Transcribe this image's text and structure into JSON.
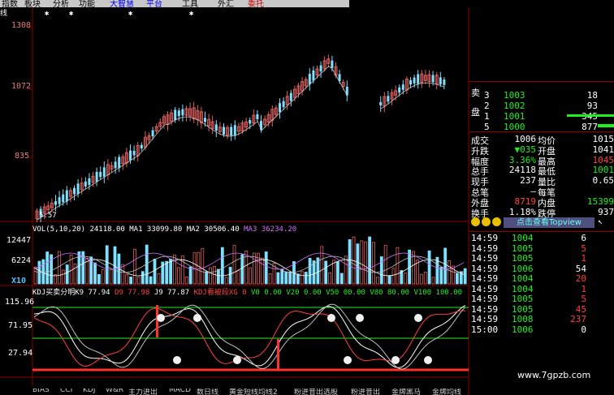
{
  "menu": {
    "items": [
      {
        "label": "指数",
        "style": "normal"
      },
      {
        "label": "板块",
        "style": "normal"
      },
      {
        "label": "分析",
        "style": "normal"
      },
      {
        "label": "功能",
        "style": "normal"
      },
      {
        "label": "大智慧",
        "style": "hi"
      },
      {
        "label": "平台",
        "style": "hi"
      },
      {
        "label": "工具",
        "style": "normal"
      },
      {
        "label": "外汇",
        "style": "normal"
      },
      {
        "label": "委托",
        "style": "red"
      }
    ]
  },
  "chart": {
    "period_label": "线",
    "price_axis": [
      "1308",
      "1072",
      "835"
    ],
    "low_label": "5.57",
    "vol_header": {
      "title": "VOL(5,10,20)",
      "v": "24118.00",
      "ma1": "MA1 33099.80",
      "ma2": "MA2 30506.40",
      "ma3": "MA3 36234.20"
    },
    "vol_axis": [
      "12447",
      "6224"
    ],
    "vol_unit": "X10",
    "kdj_header": [
      {
        "t": "KDJ买卖分明K9 77.94",
        "c": "#ffffff"
      },
      {
        "t": "D9 77.98",
        "c": "#ff4040"
      },
      {
        "t": "J9 77.87",
        "c": "#ffffff"
      },
      {
        "t": "KDJ看被段XG 0",
        "c": "#ff4040"
      },
      {
        "t": "V0 0.00",
        "c": "#1ef01e"
      },
      {
        "t": "V20 0.00",
        "c": "#1ef01e"
      },
      {
        "t": "V50 00.00",
        "c": "#1ef01e"
      },
      {
        "t": "V80 80.00",
        "c": "#1ef01e"
      },
      {
        "t": "V100 100.00",
        "c": "#1ef01e"
      }
    ],
    "kdj_axis": [
      "115.96",
      "71.95",
      "27.94"
    ]
  },
  "order_book": {
    "side_label": "卖\n\n盘",
    "rows": [
      {
        "lvl": "3",
        "price": "1003",
        "vol": "18"
      },
      {
        "lvl": "2",
        "price": "1002",
        "vol": "93"
      },
      {
        "lvl": "1",
        "price": "1001",
        "vol": "345"
      },
      {
        "lvl": "5",
        "price": "1000",
        "vol": "877"
      }
    ]
  },
  "stats": [
    {
      "l": "成交",
      "v": "1006",
      "l2": "均价",
      "v2": "1015"
    },
    {
      "l": "升跌",
      "v": "▼035",
      "l2": "开盘",
      "v2": "1041"
    },
    {
      "l": "幅度",
      "v": "3.36%",
      "l2": "最高",
      "v2": "1045"
    },
    {
      "l": "总手",
      "v": "24118",
      "l2": "最低",
      "v2": "1001"
    },
    {
      "l": "现手",
      "v": "237",
      "l2": "量比",
      "v2": "0.65"
    },
    {
      "l": "总笔",
      "v": "—",
      "l2": "每笔",
      "v2": ""
    },
    {
      "l": "外盘",
      "v": "8719",
      "l2": "内盘",
      "v2": "15399"
    },
    {
      "l": "换手",
      "v": "1.18%",
      "l2": "跌停",
      "v2": "937"
    }
  ],
  "topview_label": "点击查看Topview",
  "ticks": [
    {
      "t": "14:59",
      "p": "1004",
      "v": "6",
      "c": "white"
    },
    {
      "t": "14:59",
      "p": "1005",
      "v": "5",
      "c": "red"
    },
    {
      "t": "14:59",
      "p": "1005",
      "v": "1",
      "c": "red"
    },
    {
      "t": "14:59",
      "p": "1006",
      "v": "54",
      "c": "white"
    },
    {
      "t": "14:59",
      "p": "1004",
      "v": "20",
      "c": "red"
    },
    {
      "t": "14:59",
      "p": "1004",
      "v": "1",
      "c": "red"
    },
    {
      "t": "14:59",
      "p": "1005",
      "v": "5",
      "c": "red"
    },
    {
      "t": "14:59",
      "p": "1005",
      "v": "45",
      "c": "red"
    },
    {
      "t": "14:59",
      "p": "1008",
      "v": "237",
      "c": "red"
    },
    {
      "t": "15:00",
      "p": "1006",
      "v": "0",
      "c": "white"
    }
  ],
  "footer_url": "www.7gpzb.com",
  "bottom_tabs": [
    "BIAS",
    "CCI",
    "KDJ",
    "W&R",
    "主力进出",
    "MACD",
    "数日线",
    "黄金短线均线2",
    "粉进昔出选股",
    "粉进昔出",
    "金牌黑马",
    "金牌均线"
  ],
  "colors": {
    "up": "#e06060",
    "down": "#7ee0ff",
    "grid": "#8b0000",
    "ma": "#ffffff",
    "k": "#ffffff",
    "d": "#ff4040"
  }
}
